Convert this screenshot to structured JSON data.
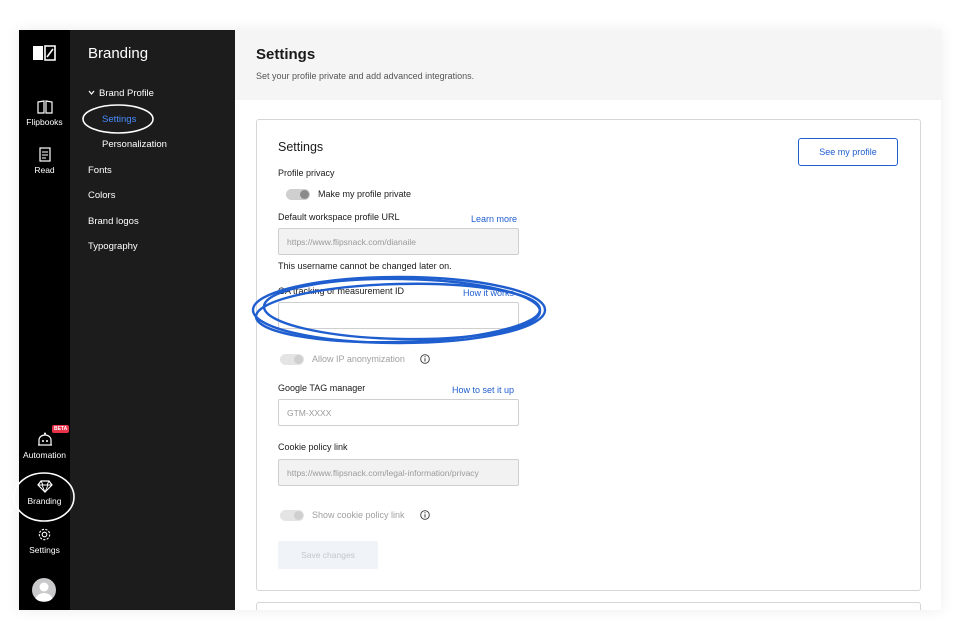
{
  "rail": {
    "items": [
      {
        "label": "Flipbooks",
        "icon": "book-icon"
      },
      {
        "label": "Read",
        "icon": "document-icon"
      },
      {
        "label": "Automation",
        "icon": "robot-icon",
        "badge": "BETA"
      },
      {
        "label": "Branding",
        "icon": "diamond-icon"
      },
      {
        "label": "Settings",
        "icon": "gear-icon"
      }
    ]
  },
  "side": {
    "title": "Branding",
    "group": "Brand Profile",
    "sub_items": [
      "Settings",
      "Personalization"
    ],
    "items": [
      "Fonts",
      "Colors",
      "Brand logos",
      "Typography"
    ]
  },
  "header": {
    "title": "Settings",
    "subtitle": "Set your profile private and add advanced integrations."
  },
  "card": {
    "title": "Settings",
    "see_profile": "See my profile",
    "privacy_label": "Profile privacy",
    "privacy_toggle": "Make my profile private",
    "url_label": "Default workspace profile URL",
    "url_link": "Learn more",
    "url_value": "https://www.flipsnack.com/dianaile",
    "url_note": "This username cannot be changed later on.",
    "ga_label": "GA tracking or measurement ID",
    "ga_link": "How it works",
    "ga_value": "",
    "ip_toggle": "Allow IP anonymization",
    "gtm_label": "Google TAG manager",
    "gtm_link": "How to set it up",
    "gtm_placeholder": "GTM-XXXX",
    "cookie_label": "Cookie policy link",
    "cookie_value": "https://www.flipsnack.com/legal-information/privacy",
    "cookie_toggle": "Show cookie policy link",
    "save": "Save changes"
  },
  "colors": {
    "accent": "#1f5ecf",
    "active_side": "#4a8cff",
    "annotation": "#1f5ecf"
  }
}
